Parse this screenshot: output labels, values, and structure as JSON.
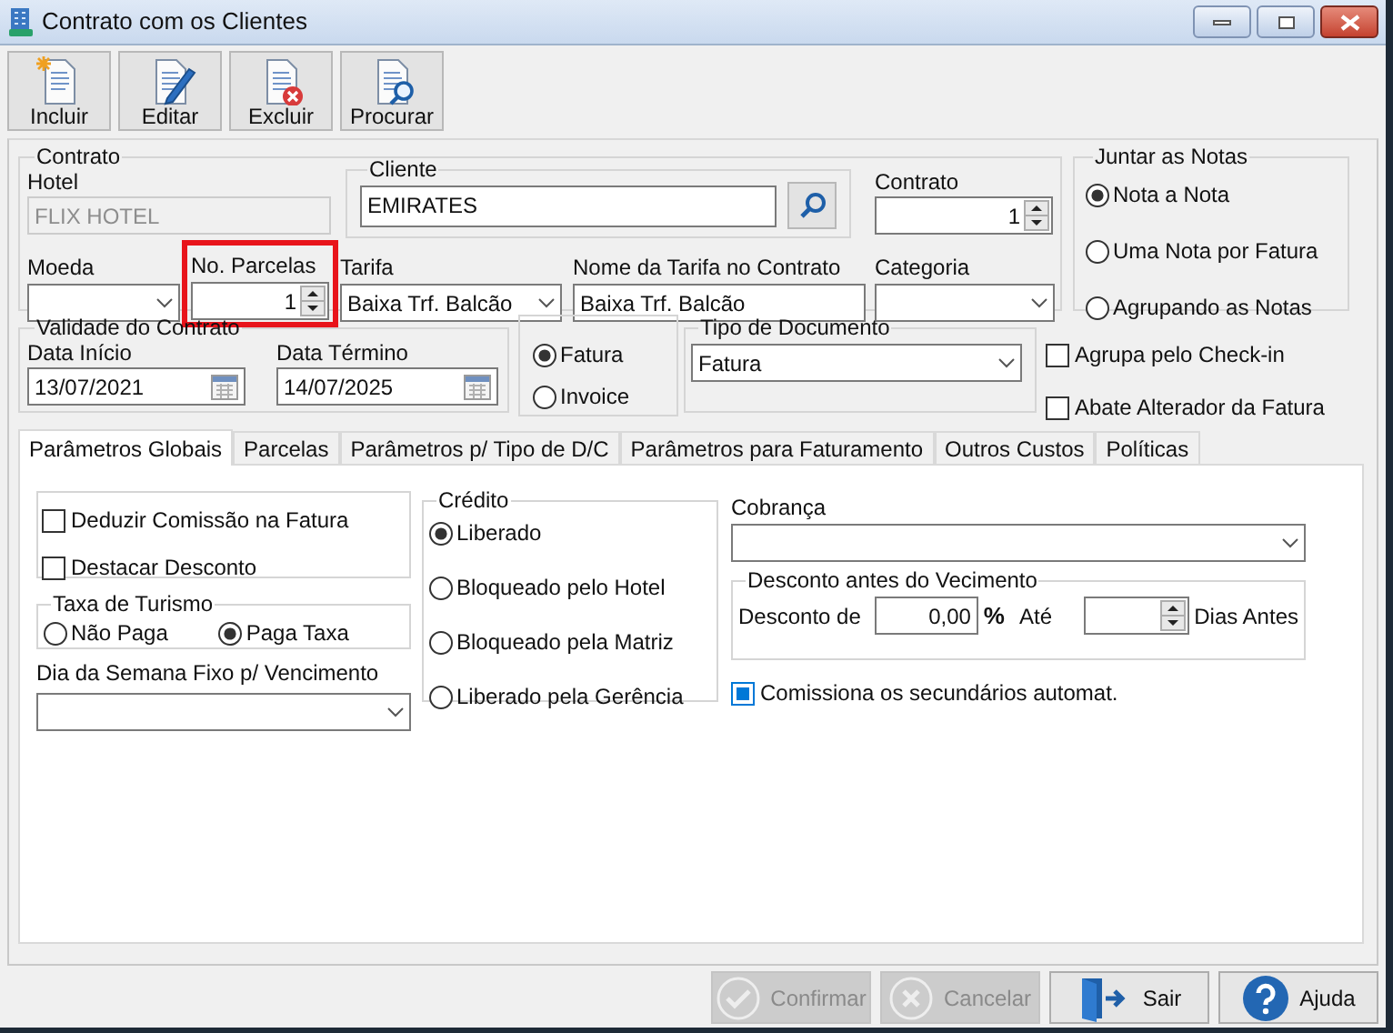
{
  "window": {
    "title": "Contrato com os Clientes"
  },
  "toolbar": [
    {
      "kind": "new",
      "label": "Incluir"
    },
    {
      "kind": "edit",
      "label": "Editar"
    },
    {
      "kind": "delete",
      "label": "Excluir"
    },
    {
      "kind": "find",
      "label": "Procurar"
    }
  ],
  "contrato": {
    "legend": "Contrato",
    "hotel": {
      "label": "Hotel",
      "value": "FLIX HOTEL",
      "disabled": true
    },
    "cliente": {
      "legend": "Cliente",
      "value": "EMIRATES"
    },
    "numero": {
      "label": "Contrato",
      "value": "1"
    },
    "moeda": {
      "label": "Moeda"
    },
    "parcelas": {
      "label": "No. Parcelas",
      "value": "1",
      "highlighted": true
    },
    "tarifa": {
      "label": "Tarifa",
      "value": "Baixa Trf. Balcão"
    },
    "nome_tarifa": {
      "label": "Nome da Tarifa no Contrato",
      "value": "Baixa Trf. Balcão"
    },
    "categoria": {
      "label": "Categoria"
    }
  },
  "juntar_notas": {
    "legend": "Juntar as Notas",
    "options": [
      {
        "label": "Nota a Nota",
        "selected": true
      },
      {
        "label": "Uma Nota por Fatura",
        "selected": false
      },
      {
        "label": "Agrupando as Notas",
        "selected": false
      }
    ]
  },
  "validade": {
    "legend": "Validade do Contrato",
    "inicio": {
      "label": "Data Início",
      "value": "13/07/2021"
    },
    "termino": {
      "label": "Data Término",
      "value": "14/07/2025"
    }
  },
  "documento": {
    "options": [
      {
        "label": "Fatura",
        "selected": true
      },
      {
        "label": "Invoice",
        "selected": false
      }
    ]
  },
  "tipo_documento": {
    "legend": "Tipo de Documento",
    "value": "Fatura"
  },
  "opcoes": [
    {
      "label": "Agrupa pelo Check-in",
      "checked": false
    },
    {
      "label": "Abate Alterador da Fatura",
      "checked": false
    }
  ],
  "tabs": [
    {
      "label": "Parâmetros Globais",
      "selected": true
    },
    {
      "label": "Parcelas",
      "selected": false
    },
    {
      "label": "Parâmetros p/ Tipo de D/C",
      "selected": false
    },
    {
      "label": "Parâmetros para Faturamento",
      "selected": false
    },
    {
      "label": "Outros Custos",
      "selected": false
    },
    {
      "label": "Políticas",
      "selected": false
    }
  ],
  "panel": {
    "flags": [
      {
        "label": "Deduzir Comissão na Fatura",
        "checked": false
      },
      {
        "label": "Destacar Desconto",
        "checked": false
      }
    ],
    "taxa_turismo": {
      "legend": "Taxa de Turismo",
      "options": [
        {
          "label": "Não Paga",
          "selected": false
        },
        {
          "label": "Paga Taxa",
          "selected": true
        }
      ]
    },
    "dia_semana": {
      "label": "Dia da Semana Fixo p/ Vencimento"
    },
    "credito": {
      "legend": "Crédito",
      "options": [
        {
          "label": "Liberado",
          "selected": true
        },
        {
          "label": "Bloqueado pelo Hotel",
          "selected": false
        },
        {
          "label": "Bloqueado pela Matriz",
          "selected": false
        },
        {
          "label": "Liberado pela Gerência",
          "selected": false
        }
      ]
    },
    "cobranca": {
      "label": "Cobrança"
    },
    "desconto": {
      "legend": "Desconto antes do Vecimento",
      "label": "Desconto de",
      "value": "0,00",
      "unit": "%",
      "ate": "Até",
      "dias": "Dias Antes"
    },
    "comissiona": {
      "label": "Comissiona os secundários automat.",
      "checked": true
    }
  },
  "footer": [
    {
      "kind": "confirm",
      "label": "Confirmar",
      "disabled": true
    },
    {
      "kind": "cancel",
      "label": "Cancelar",
      "disabled": true
    },
    {
      "kind": "exit",
      "label": "Sair",
      "disabled": false
    },
    {
      "kind": "help",
      "label": "Ajuda",
      "disabled": false
    }
  ]
}
